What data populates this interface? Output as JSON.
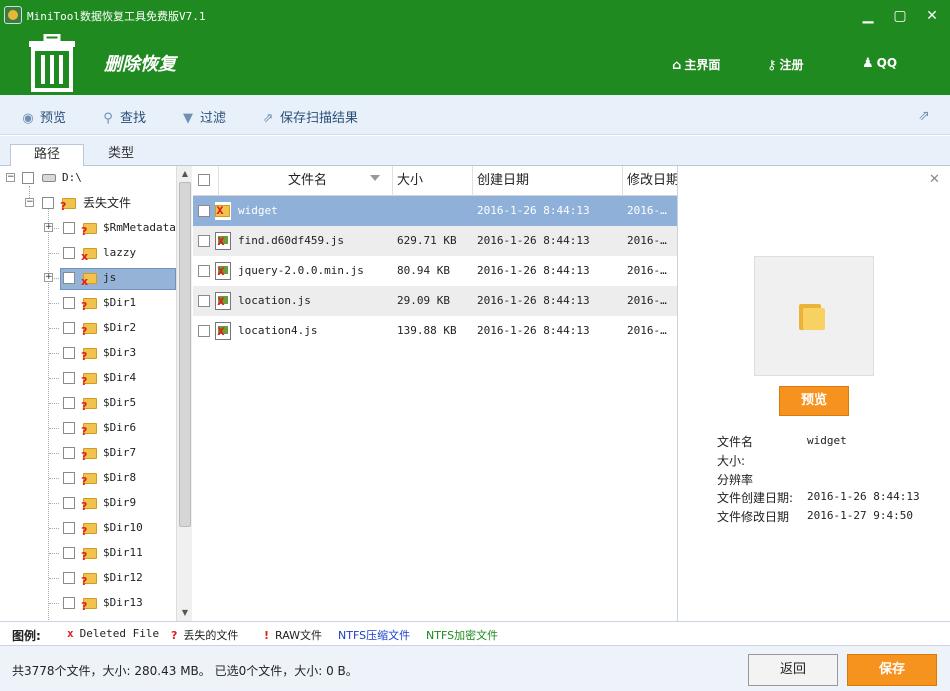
{
  "window": {
    "title": "MiniTool数据恢复工具免费版V7.1",
    "controls": {
      "minimize": "▁",
      "maximize": "▢",
      "close": "✕"
    }
  },
  "header": {
    "title": "删除恢复",
    "links": {
      "home": "主界面",
      "register": "注册",
      "qq": "QQ"
    }
  },
  "toolbar": {
    "preview": "预览",
    "find": "查找",
    "filter": "过滤",
    "save_scan": "保存扫描结果"
  },
  "tabs": {
    "path": "路径",
    "type": "类型"
  },
  "tree": {
    "drive": "D:\\",
    "lost_files": "丢失文件",
    "items": [
      {
        "label": "$RmMetadata",
        "expandable": true,
        "mark": "q"
      },
      {
        "label": "lazzy",
        "expandable": false,
        "mark": "x"
      },
      {
        "label": "js",
        "expandable": true,
        "mark": "x",
        "selected": true
      },
      {
        "label": "$Dir1",
        "expandable": false,
        "mark": "q"
      },
      {
        "label": "$Dir2",
        "expandable": false,
        "mark": "q"
      },
      {
        "label": "$Dir3",
        "expandable": false,
        "mark": "q"
      },
      {
        "label": "$Dir4",
        "expandable": false,
        "mark": "q"
      },
      {
        "label": "$Dir5",
        "expandable": false,
        "mark": "q"
      },
      {
        "label": "$Dir6",
        "expandable": false,
        "mark": "q"
      },
      {
        "label": "$Dir7",
        "expandable": false,
        "mark": "q"
      },
      {
        "label": "$Dir8",
        "expandable": false,
        "mark": "q"
      },
      {
        "label": "$Dir9",
        "expandable": false,
        "mark": "q"
      },
      {
        "label": "$Dir10",
        "expandable": false,
        "mark": "q"
      },
      {
        "label": "$Dir11",
        "expandable": false,
        "mark": "q"
      },
      {
        "label": "$Dir12",
        "expandable": false,
        "mark": "q"
      },
      {
        "label": "$Dir13",
        "expandable": false,
        "mark": "q"
      }
    ]
  },
  "filelist": {
    "columns": {
      "name": "文件名",
      "size": "大小",
      "created": "创建日期",
      "modified": "修改日期"
    },
    "rows": [
      {
        "name": "widget",
        "size": "",
        "created": "2016-1-26 8:44:13",
        "modified": "2016-…",
        "kind": "folder",
        "selected": true
      },
      {
        "name": "find.d60df459.js",
        "size": "629.71 KB",
        "created": "2016-1-26 8:44:13",
        "modified": "2016-…",
        "kind": "file"
      },
      {
        "name": "jquery-2.0.0.min.js",
        "size": "80.94 KB",
        "created": "2016-1-26 8:44:13",
        "modified": "2016-…",
        "kind": "file"
      },
      {
        "name": "location.js",
        "size": "29.09 KB",
        "created": "2016-1-26 8:44:13",
        "modified": "2016-…",
        "kind": "file"
      },
      {
        "name": "location4.js",
        "size": "139.88 KB",
        "created": "2016-1-26 8:44:13",
        "modified": "2016-…",
        "kind": "file"
      }
    ]
  },
  "preview": {
    "button": "预览",
    "labels": {
      "name": "文件名",
      "size": "大小:",
      "resolution": "分辨率",
      "created": "文件创建日期:",
      "modified": "文件修改日期"
    },
    "values": {
      "name": "widget",
      "size": "",
      "resolution": "",
      "created": "2016-1-26 8:44:13",
      "modified": "2016-1-27 9:4:50"
    }
  },
  "legend": {
    "title": "图例:",
    "deleted": "Deleted File",
    "lost": "丢失的文件",
    "raw": "RAW文件",
    "ntfs_compressed": "NTFS压缩文件",
    "ntfs_encrypted": "NTFS加密文件",
    "colors": {
      "ntfs_compressed": "#1a3fc9",
      "ntfs_encrypted": "#1b8a1b",
      "mark": "#e01f1f"
    }
  },
  "status": {
    "text": "共3778个文件，大小: 280.43 MB。  已选0个文件，大小: 0 B。",
    "back_button": "返回",
    "save_button": "保存"
  },
  "colors": {
    "header_bg": "#1f8a1f",
    "accent_orange": "#f6931e",
    "selection": "#8fb0d8"
  }
}
